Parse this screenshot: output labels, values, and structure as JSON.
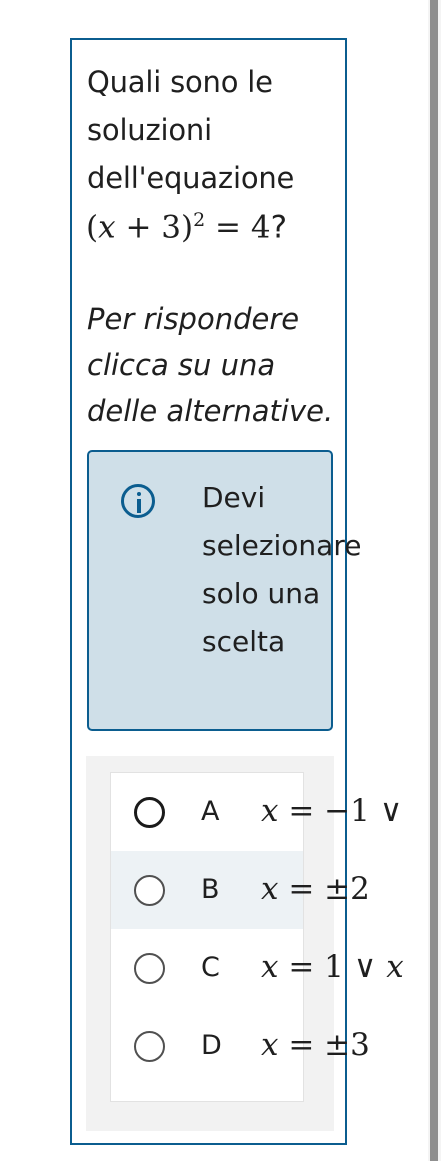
{
  "question": {
    "text_line1": "Quali sono le soluzioni dell'equazione",
    "math": {
      "open": "(",
      "var": "x",
      "plus": " + 3)",
      "exponent": "2",
      "equals": " = 4",
      "qmark": "?"
    },
    "instruction": "Per rispondere clicca su una delle alternative."
  },
  "info": {
    "icon": "info-icon",
    "text": "Devi selezionare solo una scelta"
  },
  "choices": [
    {
      "letter": "A",
      "var": "x",
      "rhs": " = −1 ∨ ",
      "rhs2": ""
    },
    {
      "letter": "B",
      "var": "x",
      "rhs": " = ±2",
      "rhs2": ""
    },
    {
      "letter": "C",
      "var": "x",
      "rhs": " = 1 ∨ ",
      "rhs2": "x"
    },
    {
      "letter": "D",
      "var": "x",
      "rhs": " = ±3",
      "rhs2": ""
    }
  ],
  "colors": {
    "accent": "#0b5d8f",
    "info_bg": "#cfdfe8",
    "panel_bg": "#f2f2f2",
    "hover_bg": "#edf2f5"
  }
}
